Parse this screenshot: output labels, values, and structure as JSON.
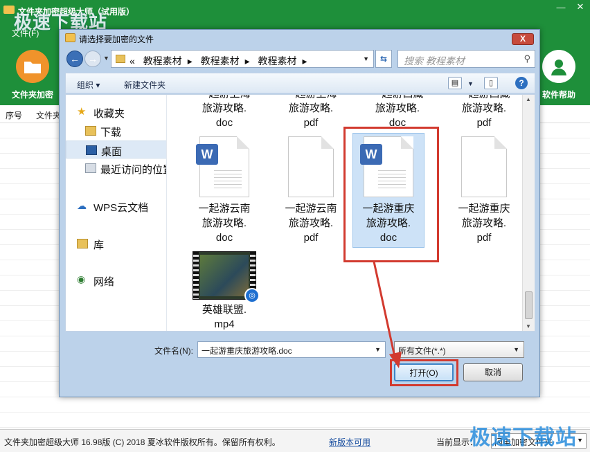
{
  "app": {
    "title": "文件夹加密超级大师（试用版）",
    "menu": "文件(F)",
    "tools": [
      {
        "label": "文件夹加密"
      },
      {
        "label": "软件帮助"
      }
    ],
    "columns": [
      "序号",
      "文件夹"
    ],
    "status": {
      "copyright": "文件夹加密超级大师 16.98版 (C) 2018  夏冰软件版权所有。保留所有权利。",
      "link": "新版本可用",
      "display_label": "当前显示：",
      "display_value": "闪电加密文件夹"
    },
    "watermark": "极速下载站"
  },
  "dialog": {
    "title": "请选择要加密的文件",
    "close": "X",
    "breadcrumb_prefix": "«",
    "breadcrumbs": [
      "教程素材",
      "教程素材",
      "教程素材"
    ],
    "search_placeholder": "搜索 教程素材",
    "toolbar": {
      "organize": "组织 ▾",
      "new_folder": "新建文件夹"
    },
    "nav": [
      {
        "label": "收藏夹"
      },
      {
        "label": "下载"
      },
      {
        "label": "桌面"
      },
      {
        "label": "最近访问的位置"
      },
      {
        "label": "WPS云文档"
      },
      {
        "label": "库"
      },
      {
        "label": "网络"
      }
    ],
    "files_partial": [
      {
        "line1": "一起游上海",
        "line2": "旅游攻略.",
        "line3": "doc"
      },
      {
        "line1": "一起游上海",
        "line2": "旅游攻略.",
        "line3": "pdf"
      },
      {
        "line1": "一起游西藏",
        "line2": "旅游攻略.",
        "line3": "doc"
      },
      {
        "line1": "一起游西藏",
        "line2": "旅游攻略.",
        "line3": "pdf"
      }
    ],
    "files": [
      {
        "line1": "一起游云南",
        "line2": "旅游攻略.",
        "line3": "doc",
        "icon": "word"
      },
      {
        "line1": "一起游云南",
        "line2": "旅游攻略.",
        "line3": "pdf",
        "icon": "blank"
      },
      {
        "line1": "一起游重庆",
        "line2": "旅游攻略.",
        "line3": "doc",
        "icon": "word",
        "selected": true
      },
      {
        "line1": "一起游重庆",
        "line2": "旅游攻略.",
        "line3": "pdf",
        "icon": "blank"
      },
      {
        "line1": "英雄联盟.",
        "line2": "mp4",
        "line3": "",
        "icon": "video"
      }
    ],
    "filename_label": "文件名(N):",
    "filename_value": "一起游重庆旅游攻略.doc",
    "filetype_value": "所有文件(*.*)",
    "open_button": "打开(O)",
    "cancel_button": "取消"
  },
  "colors": {
    "app_green": "#1e8f3a",
    "annotation_red": "#d23a2f",
    "dialog_frame": "#bcd2ea"
  }
}
